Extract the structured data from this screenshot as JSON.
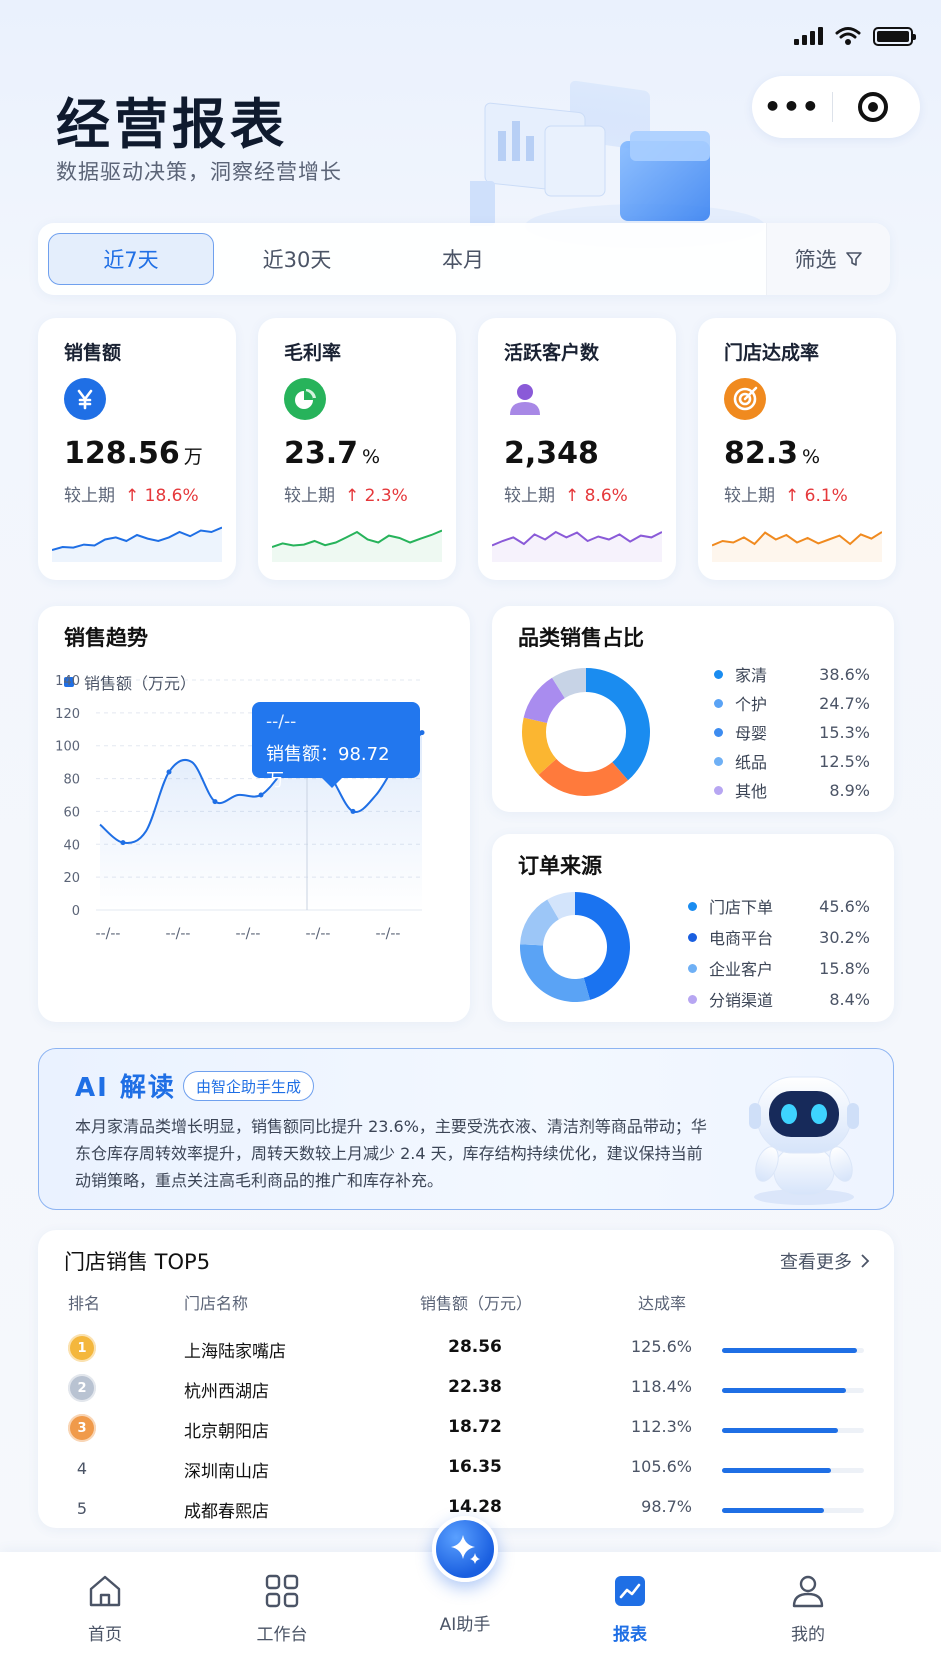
{
  "header": {
    "title": "经营报表",
    "subtitle": "数据驱动决策，洞察经营增长"
  },
  "capsule": {
    "more_icon": "more-icon",
    "target_icon": "target-icon"
  },
  "tabs": [
    {
      "label": "近7天",
      "active": true
    },
    {
      "label": "近30天",
      "active": false
    },
    {
      "label": "本月",
      "active": false
    }
  ],
  "filter_label": "筛选",
  "kpis": [
    {
      "label": "销售额",
      "value": "128.56",
      "unit": "万",
      "compare_label": "较上期",
      "change": "↑ 18.6%",
      "icon": "yen-icon",
      "color": "#1f6fe5",
      "trend": [
        0.2,
        0.3,
        0.28,
        0.38,
        0.35,
        0.55,
        0.62,
        0.5,
        0.7,
        0.58,
        0.5,
        0.62,
        0.8,
        0.66,
        0.85,
        0.8,
        0.95
      ]
    },
    {
      "label": "毛利率",
      "value": "23.7",
      "unit": "%",
      "compare_label": "较上期",
      "change": "↑ 2.3%",
      "icon": "pie-icon",
      "color": "#27b35b",
      "trend": [
        0.3,
        0.42,
        0.35,
        0.38,
        0.5,
        0.36,
        0.45,
        0.62,
        0.8,
        0.55,
        0.45,
        0.68,
        0.6,
        0.45,
        0.58,
        0.7,
        0.85
      ]
    },
    {
      "label": "活跃客户数",
      "value": "2,348",
      "unit": "",
      "compare_label": "较上期",
      "change": "↑ 8.6%",
      "icon": "user-icon",
      "color": "#8a5ad8",
      "trend": [
        0.35,
        0.5,
        0.62,
        0.4,
        0.72,
        0.55,
        0.8,
        0.62,
        0.78,
        0.5,
        0.65,
        0.55,
        0.72,
        0.48,
        0.68,
        0.62,
        0.8
      ]
    },
    {
      "label": "门店达成率",
      "value": "82.3",
      "unit": "%",
      "compare_label": "较上期",
      "change": "↑ 6.1%",
      "icon": "goal-icon",
      "color": "#f08a1f",
      "trend": [
        0.35,
        0.5,
        0.45,
        0.62,
        0.4,
        0.78,
        0.55,
        0.7,
        0.45,
        0.6,
        0.42,
        0.55,
        0.68,
        0.4,
        0.72,
        0.58,
        0.8
      ]
    }
  ],
  "sales_trend": {
    "title": "销售趋势",
    "legend": "销售额（万元）",
    "tooltip": {
      "date": "--/--",
      "text": "销售额：98.72万"
    }
  },
  "chart_data": {
    "type": "line",
    "title": "销售趋势",
    "series": [
      {
        "name": "销售额（万元）",
        "values": [
          52,
          41,
          48,
          84,
          90,
          66,
          70,
          70,
          85,
          98.72,
          82,
          60,
          70,
          92,
          108
        ]
      }
    ],
    "x_tick_labels": [
      "--/--",
      "--/--",
      "--/--",
      "--/--",
      "--/--"
    ],
    "ylim": [
      0,
      140
    ],
    "y_ticks": [
      0,
      20,
      40,
      60,
      80,
      100,
      120,
      140
    ],
    "highlight_index": 9,
    "grid": true
  },
  "category_share": {
    "title": "品类销售占比",
    "items": [
      {
        "name": "家清",
        "pct": "38.6%",
        "value": 38.6,
        "color": "#1a8cf0"
      },
      {
        "name": "个护",
        "pct": "24.7%",
        "value": 24.7,
        "color": "#ff7a3c"
      },
      {
        "name": "母婴",
        "pct": "15.3%",
        "value": 15.3,
        "color": "#fbb631"
      },
      {
        "name": "纸品",
        "pct": "12.5%",
        "value": 12.5,
        "color": "#a98cef"
      },
      {
        "name": "其他",
        "pct": "8.9%",
        "value": 8.9,
        "color": "#c7d3e6"
      }
    ]
  },
  "order_source": {
    "title": "订单来源",
    "items": [
      {
        "name": "门店下单",
        "pct": "45.6%",
        "value": 45.6,
        "color": "#1a73f0"
      },
      {
        "name": "电商平台",
        "pct": "30.2%",
        "value": 30.2,
        "color": "#5aa3f5"
      },
      {
        "name": "企业客户",
        "pct": "15.8%",
        "value": 15.8,
        "color": "#9cc6f7"
      },
      {
        "name": "分销渠道",
        "pct": "8.4%",
        "value": 8.4,
        "color": "#d3e4fb"
      }
    ]
  },
  "ai": {
    "title": "AI 解读",
    "badge": "由智企助手生成",
    "text": "本月家清品类增长明显，销售额同比提升 23.6%，主要受洗衣液、清洁剂等商品带动；华东仓库存周转效率提升，周转天数较上月减少 2.4 天，库存结构持续优化，建议保持当前动销策略，重点关注高毛利商品的推广和库存补充。"
  },
  "top5": {
    "title": "门店销售 TOP5",
    "more": "查看更多",
    "headers": [
      "排名",
      "门店名称",
      "销售额（万元）",
      "达成率"
    ],
    "rows": [
      {
        "rank": "1",
        "name": "上海陆家嘴店",
        "sales": "28.56",
        "rate": "125.6%",
        "progress": 0.95,
        "medal": "#f4b73d"
      },
      {
        "rank": "2",
        "name": "杭州西湖店",
        "sales": "22.38",
        "rate": "118.4%",
        "progress": 0.87,
        "medal": "#b9c3d2"
      },
      {
        "rank": "3",
        "name": "北京朝阳店",
        "sales": "18.72",
        "rate": "112.3%",
        "progress": 0.82,
        "medal": "#f09a4a"
      },
      {
        "rank": "4",
        "name": "深圳南山店",
        "sales": "16.35",
        "rate": "105.6%",
        "progress": 0.77,
        "medal": ""
      },
      {
        "rank": "5",
        "name": "成都春熙店",
        "sales": "14.28",
        "rate": "98.7%",
        "progress": 0.72,
        "medal": ""
      }
    ]
  },
  "nav": [
    {
      "label": "首页",
      "icon": "home-icon"
    },
    {
      "label": "工作台",
      "icon": "grid-icon"
    },
    {
      "label": "AI助手",
      "icon": "sparkle-icon"
    },
    {
      "label": "报表",
      "icon": "chart-icon",
      "active": true
    },
    {
      "label": "我的",
      "icon": "person-icon"
    }
  ]
}
